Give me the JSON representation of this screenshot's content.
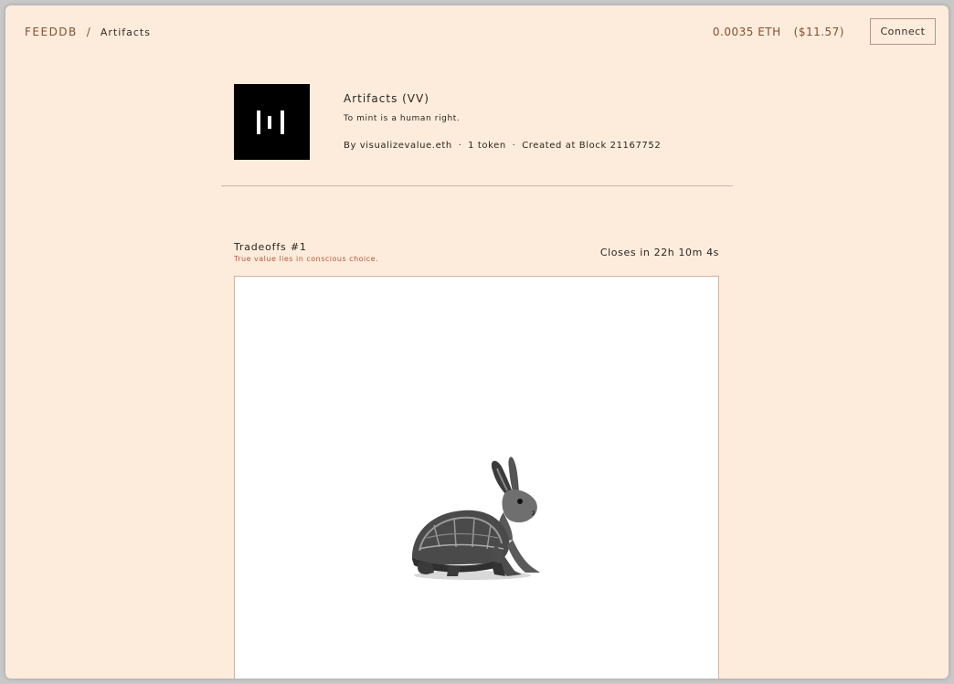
{
  "header": {
    "brand": "FEEDDB",
    "separator": "/",
    "breadcrumb": "Artifacts",
    "eth_price": "0.0035 ETH",
    "usd_price": "($11.57)",
    "connect_label": "Connect"
  },
  "collection": {
    "logo_icon": "vv-logo-icon",
    "title": "Artifacts (VV)",
    "description": "To mint is a human right.",
    "author": "By visualizevalue.eth",
    "dot": "·",
    "token_count": "1 token",
    "created": "Created at Block 21167752"
  },
  "token": {
    "title": "Tradeoffs #1",
    "subtitle": "True value lies in conscious choice.",
    "closes": "Closes in 22h 10m 4s",
    "image_icon": "tortoise-rabbit-artwork"
  },
  "colors": {
    "background": "#fdecdc",
    "accent": "#8a4c2c",
    "subtitle": "#b5573a",
    "border": "#d4b0a2"
  }
}
